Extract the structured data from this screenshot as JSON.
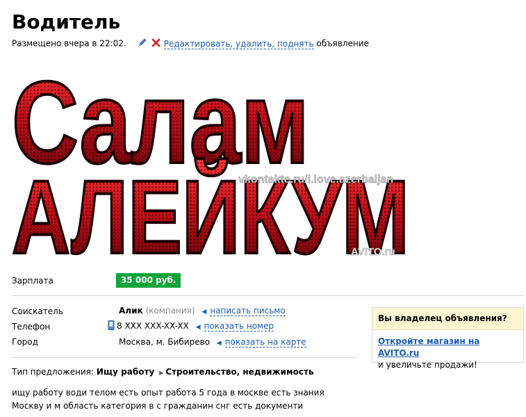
{
  "ad": {
    "title": "Водитель",
    "posted": "Размещено вчера в 22:02.",
    "edit_link": "Редактировать, удалить, поднять",
    "edit_suffix": "объявление"
  },
  "banner": {
    "line1": "Салам",
    "line2": "АЛЕЙКУМ",
    "watermark": "vkontakte.ru/i.love.azerbaijan",
    "logo": "AVITO.ru"
  },
  "details": {
    "salary_label": "Зарплата",
    "salary_value": "35 000 руб.",
    "applicant_label": "Соискатель",
    "applicant_name": "Алик",
    "applicant_type": "(компания)",
    "write_link": "написать письмо",
    "phone_label": "Телефон",
    "phone_value": "8 XXX XXX-XX-XX",
    "show_phone_link": "показать номер",
    "city_label": "Город",
    "city_value": "Москва, м. Бибирево",
    "map_link": "показать на карте"
  },
  "offer": {
    "type_label": "Тип предложения:",
    "type_value": "Ищу работу",
    "category": "Строительство, недвижимость"
  },
  "description": {
    "line1": "ищу работу води телом есть опыт работа 5 года в москве есть знания",
    "line2": "Москву и м область категория в с гражданин снг есть документи"
  },
  "owner_box": {
    "heading": "Вы владелец объявления?",
    "shop_link": "Откройте магазин на AVITO.ru",
    "tail": "и увеличьте продажи!"
  },
  "colors": {
    "link": "#1a5cb0",
    "salary_bg": "#13a33a",
    "owner_head_bg": "#fdf6d3",
    "banner_red": "#c4101a"
  },
  "icons": [
    "pencil-icon",
    "delete-icon",
    "phone-icon",
    "triangle-left-icon",
    "triangle-right-icon"
  ]
}
